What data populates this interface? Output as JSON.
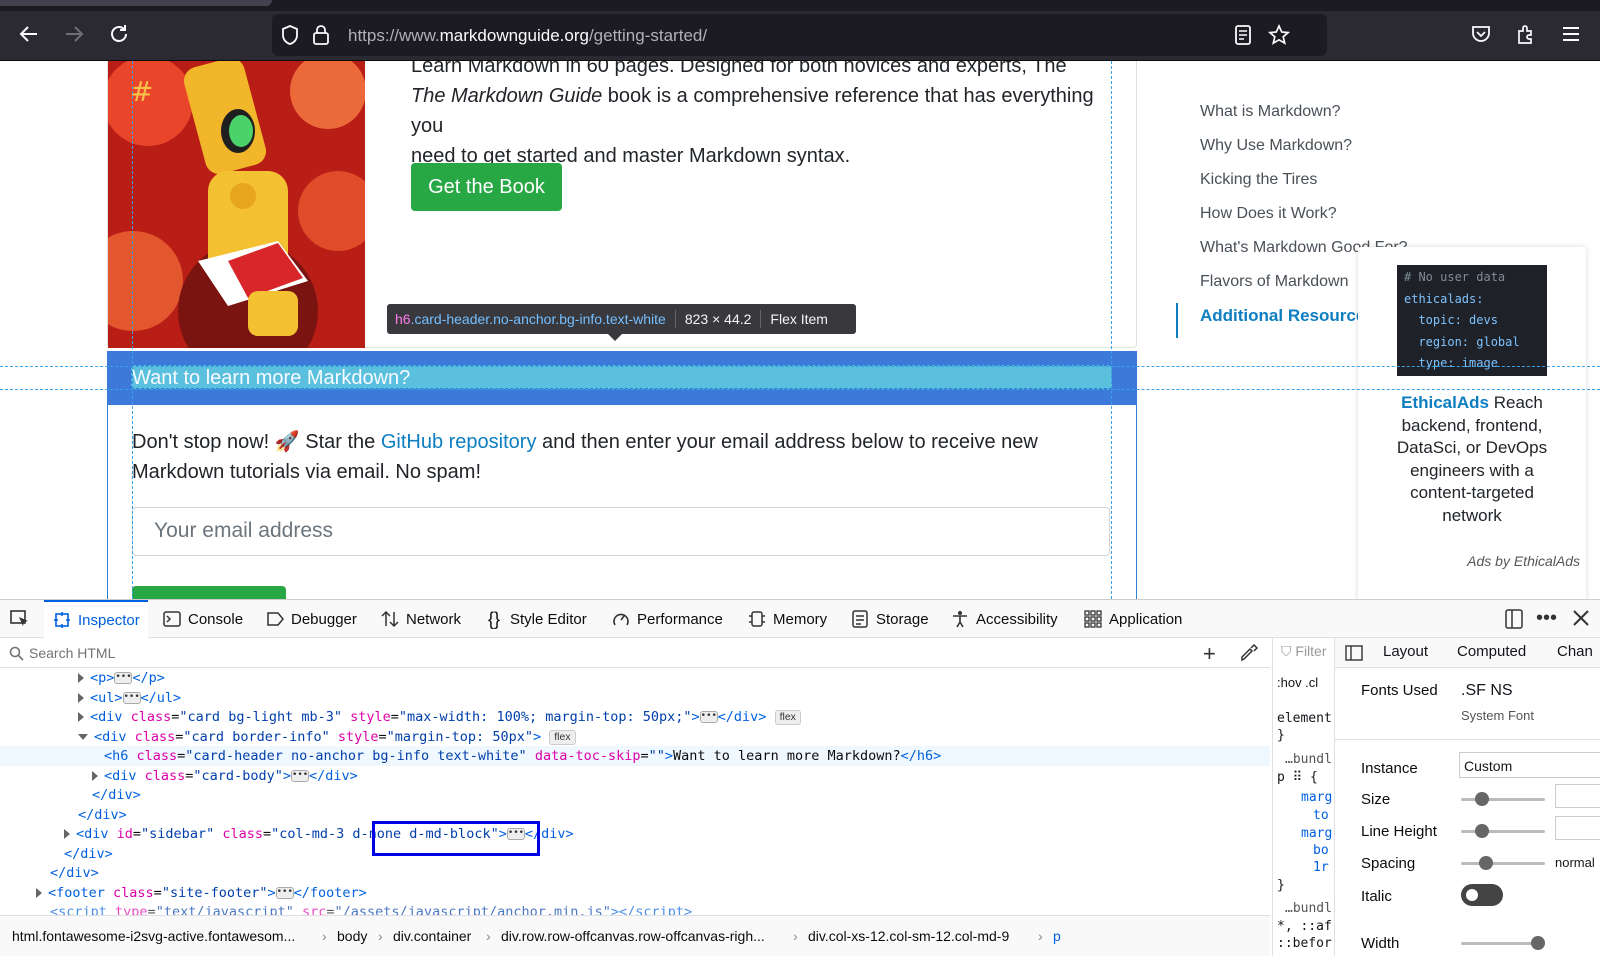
{
  "browser": {
    "url_host": "https://www.markdownguide.org",
    "url_path": "/getting-started/"
  },
  "page": {
    "book_text_line1": "Learn Markdown in 60 pages. Designed for both novices and experts, The",
    "book_text_line2": "Markdown Guide book is a comprehensive reference that has everything you",
    "book_text_line3": "need to get started and master Markdown syntax.",
    "get_book": "Get the Book",
    "toc": [
      "What is Markdown?",
      "Why Use Markdown?",
      "Kicking the Tires",
      "How Does it Work?",
      "What's Markdown Good For?",
      "Flavors of Markdown",
      "Additional Resources"
    ],
    "ad_code": [
      "# No user data",
      "ethicalads:",
      "  topic: devs",
      "  region: global",
      "  type: image"
    ],
    "ad_brand": "EthicalAds",
    "ad_text": " Reach backend, frontend, DataSci, or DevOps engineers with a content-targeted network",
    "ad_footer": "Ads by EthicalAds",
    "tooltip_tag": "h6",
    "tooltip_class": ".card-header.no-anchor.bg-info.text-white",
    "tooltip_size": "823 × 44.2",
    "tooltip_kind": "Flex Item",
    "card_header": "Want to learn more Markdown?",
    "card_text_a": "Don't stop now! 🚀 Star the ",
    "card_link": "GitHub repository",
    "card_text_b": " and then enter your email address below to receive new Markdown tutorials via email. No spam!",
    "email_placeholder": "Your email address"
  },
  "devtools": {
    "tabs": [
      "Inspector",
      "Console",
      "Debugger",
      "Network",
      "Style Editor",
      "Performance",
      "Memory",
      "Storage",
      "Accessibility",
      "Application"
    ],
    "search_placeholder": "Search HTML",
    "filter_placeholder": "Filter",
    "breadcrumbs": [
      "html.fontawesome-i2svg-active.fontawesom...",
      "body",
      "div.container",
      "div.row.row-offcanvas.row-offcanvas-righ...",
      "div.col-xs-12.col-sm-12.col-md-9",
      "p"
    ],
    "layout_tabs": [
      "Layout",
      "Computed",
      "Chan"
    ],
    "fonts_used_label": "Fonts Used",
    "font_name": ".SF NS",
    "font_source": "System Font",
    "instance_label": "Instance",
    "instance_value": "Custom",
    "size_label": "Size",
    "line_height_label": "Line Height",
    "spacing_label": "Spacing",
    "spacing_value": "normal",
    "italic_label": "Italic",
    "width_label": "Width",
    "rules_lines": [
      ":hov .cl",
      "element",
      "}",
      "…bundl",
      "p ⠿ {",
      "marg",
      "to",
      "marg",
      "bo",
      "1r",
      "}",
      "…bundl",
      "*, ::af",
      "::befor"
    ]
  },
  "colors": {
    "accent": "#0060df",
    "card_header_bg": "#5bc0de",
    "highlight_box": "#0000e6",
    "green_button": "#28a745"
  }
}
